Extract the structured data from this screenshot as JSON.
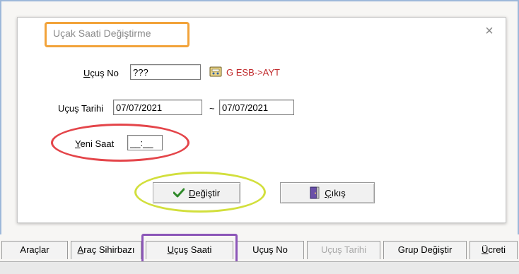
{
  "dialog": {
    "title": "Uçak Saati Değiştirme",
    "close_icon": "close-icon"
  },
  "form": {
    "flight_no": {
      "label_accel": "U",
      "label_rest": "çuş No",
      "value": "???"
    },
    "route": {
      "icon": "route-icon",
      "text": "G  ESB->AYT"
    },
    "flight_date": {
      "label": "Uçuş Tarihi",
      "from": "07/07/2021",
      "sep": "~",
      "to": "07/07/2021"
    },
    "new_time": {
      "label_accel": "Y",
      "label_rest": "eni Saat",
      "value": "__:__"
    }
  },
  "buttons": {
    "change": {
      "icon": "checkmark-icon",
      "label_accel": "D",
      "label_rest": "eğiştir"
    },
    "exit": {
      "icon": "exit-door-icon",
      "label_accel": "Ç",
      "label_rest": "ıkış"
    }
  },
  "tabs": [
    {
      "label": "Araçlar"
    },
    {
      "label_accel": "A",
      "label_rest": "raç Sihirbazı"
    },
    {
      "label_accel": "U",
      "label_rest": "çuş Saati"
    },
    {
      "label": "Uçuş No"
    },
    {
      "label": "Uçuş Tarihi",
      "disabled": true
    },
    {
      "label": "Grup Değiştir"
    },
    {
      "label_accel": "Ü",
      "label_rest": "creti"
    }
  ],
  "colors": {
    "title_highlight": "#f2a33a",
    "new_time_highlight": "#e4454a",
    "change_button_highlight": "#d2df3c",
    "tab_highlight": "#8c56b8",
    "route_text": "#c0282a"
  }
}
